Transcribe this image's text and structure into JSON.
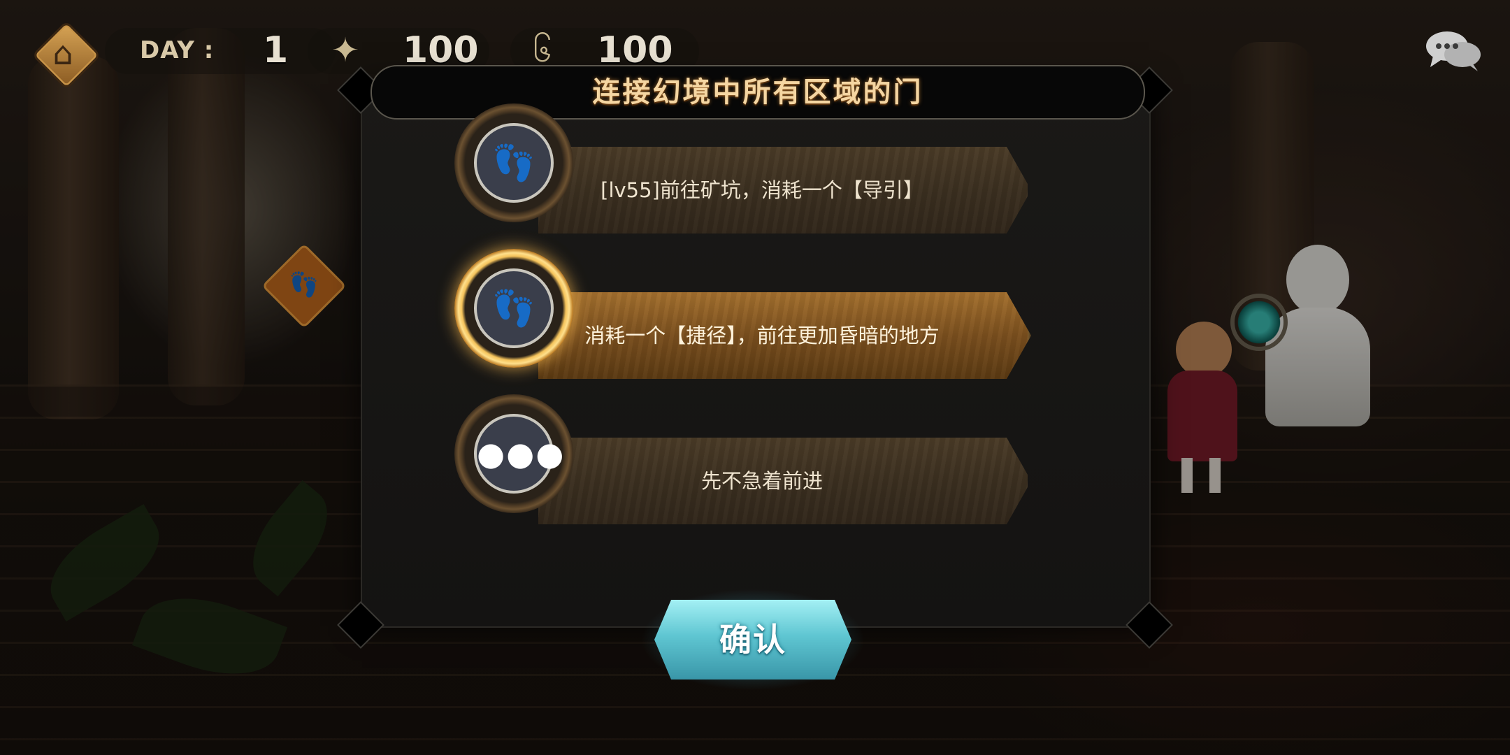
{
  "hud": {
    "day_label": "DAY :",
    "day_value": "1",
    "stat1_value": "100",
    "stat2_value": "100",
    "icons": [
      "home-icon",
      "person-icon",
      "swirl-icon",
      "chat-icon"
    ]
  },
  "dialog": {
    "title": "连接幻境中所有区域的门",
    "options": [
      {
        "label": "[lv55]前往矿坑，消耗一个【导引】",
        "icon": "footprints-icon",
        "selected": false
      },
      {
        "label": "消耗一个【捷径】，前往更加昏暗的地方",
        "icon": "footprints-icon",
        "selected": true
      },
      {
        "label": "先不急着前进",
        "icon": "ellipsis-icon",
        "selected": false
      }
    ],
    "confirm_label": "确认"
  },
  "colors": {
    "title_text": "#f5d6a2",
    "selected_glow": "#ffcf6a",
    "confirm_button": "#5fc6d2"
  }
}
